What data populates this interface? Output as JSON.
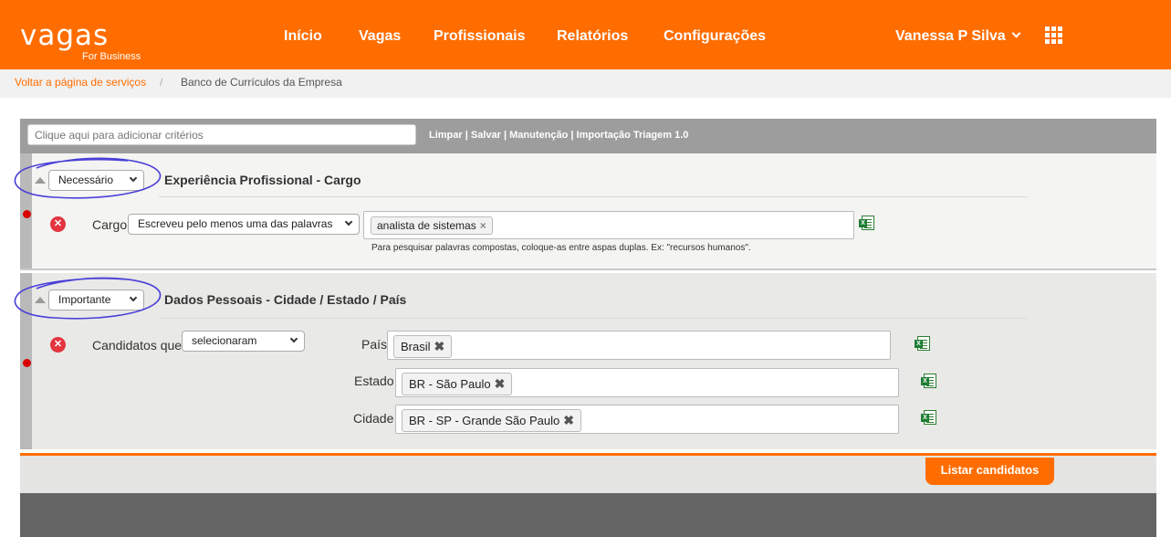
{
  "brand": {
    "logo_main": "vagas",
    "logo_sub": "For Business"
  },
  "nav": {
    "items": [
      "Início",
      "Vagas",
      "Profissionais",
      "Relatórios",
      "Configurações"
    ]
  },
  "user": {
    "name": "Vanessa P Silva"
  },
  "breadcrumb": {
    "back": "Voltar a página de serviços",
    "separator": "/",
    "current": "Banco de Currículos da Empresa"
  },
  "toolbar": {
    "criteria_placeholder": "Clique aqui para adicionar critérios",
    "links": [
      "Limpar",
      "Salvar",
      "Manutenção",
      "Importação Triagem 1.0"
    ],
    "separator": "|"
  },
  "section1": {
    "priority": "Necessário",
    "title": "Experiência Profissional - Cargo",
    "field_label": "Cargo",
    "condition": "Escreveu pelo menos uma das palavras",
    "tags": [
      "analista de sistemas"
    ],
    "hint": "Para pesquisar palavras compostas, coloque-as entre aspas duplas. Ex: \"recursos humanos\"."
  },
  "section2": {
    "priority": "Importante",
    "title": "Dados Pessoais - Cidade / Estado / País",
    "field_label": "Candidatos que",
    "condition": "selecionaram",
    "rows": [
      {
        "label": "País",
        "tag": "Brasil"
      },
      {
        "label": "Estado",
        "tag": "BR - São Paulo"
      },
      {
        "label": "Cidade",
        "tag": "BR - SP - Grande São Paulo"
      }
    ]
  },
  "footer": {
    "list_button": "Listar candidatos"
  },
  "colors": {
    "brand_orange": "#ff6d00",
    "annotation_purple": "#4a3fd8",
    "remove_red": "#e3343f"
  }
}
